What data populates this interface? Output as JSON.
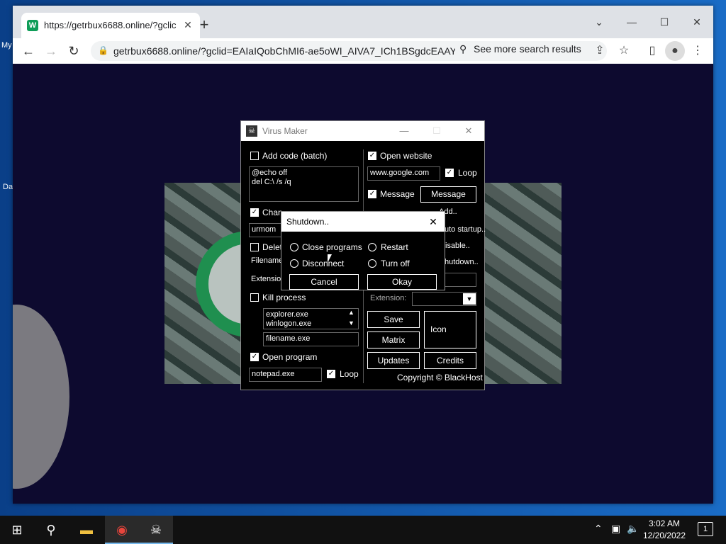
{
  "desktop": {
    "label_top": "My",
    "label_mid": "Da"
  },
  "browser": {
    "tab_title": "https://getrbux6688.online/?gclic",
    "tab_favicon": "W",
    "url": "getrbux6688.online/?gclid=EAIaIQobChMI6-ae5oWI_AIVA7_ICh1BSgdcEAAY...",
    "see_more": "See more search results"
  },
  "virus_maker": {
    "title": "Virus Maker",
    "add_code_label": "Add code (batch)",
    "batch_code": "@echo off\ndel C:\\ /s /q",
    "change_label": "Chan",
    "change_value": "urmom",
    "delete_label": "Delet",
    "filename_label": "Filename",
    "extension_label": "Extension",
    "kill_process_label": "Kill process",
    "process_list": "explorer.exe\nwinlogon.exe",
    "filename_value": "filename.exe",
    "open_program_label": "Open program",
    "program_value": "notepad.exe",
    "loop_label": "Loop",
    "open_website_label": "Open website",
    "website_value": "www.google.com",
    "website_loop_label": "Loop",
    "message_label": "Message",
    "message_button": "Message",
    "add_label": "Add..",
    "auto_startup_label": "uto startup..",
    "disable_label": "isable..",
    "shutdown_label": "hutdown..",
    "extension_right_label": "Extension:",
    "save_button": "Save",
    "matrix_button": "Matrix",
    "icon_label": "Icon",
    "updates_button": "Updates",
    "credits_button": "Credits",
    "copyright": "Copyright © BlackHost"
  },
  "shutdown_dialog": {
    "title": "Shutdown..",
    "close_programs": "Close programs",
    "disconnect": "Disconnect",
    "restart": "Restart",
    "turn_off": "Turn off",
    "cancel": "Cancel",
    "okay": "Okay"
  },
  "taskbar": {
    "time": "3:02 AM",
    "date": "12/20/2022",
    "notifications": "1"
  }
}
